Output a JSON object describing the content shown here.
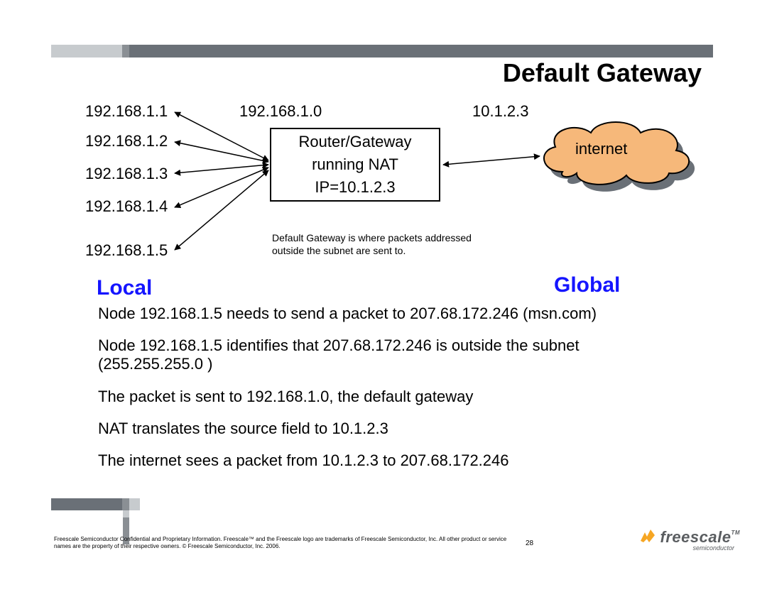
{
  "title": "Default Gateway",
  "ips": [
    "192.168.1.1",
    "192.168.1.2",
    "192.168.1.3",
    "192.168.1.4",
    "192.168.1.5"
  ],
  "gateway_lan_ip": "192.168.1.0",
  "gateway_wan_ip": "10.1.2.3",
  "router": {
    "line1": "Router/Gateway",
    "line2": "running NAT",
    "line3": "IP=10.1.2.3"
  },
  "cloud_label": "internet",
  "explanation": "Default Gateway is where packets addressed outside the subnet are sent to.",
  "local_label": "Local",
  "global_label": "Global",
  "body": [
    "Node 192.168.1.5 needs to send a packet to 207.68.172.246 (msn.com)",
    "Node 192.168.1.5 identifies that 207.68.172.246 is outside the subnet (255.255.255.0 )",
    "The packet is sent to 192.168.1.0, the default gateway",
    "NAT translates the source field to 10.1.2.3",
    "The internet sees a packet from 10.1.2.3 to 207.68.172.246"
  ],
  "footnote": "Freescale Semiconductor Confidential and Proprietary Information. Freescale™ and the Freescale logo are trademarks of Freescale Semiconductor, Inc. All other product or service names are the property of their respective owners. © Freescale Semiconductor, Inc. 2006.",
  "page_number": "28",
  "logo": {
    "name": "freescale",
    "sub": "semiconductor",
    "tm": "TM"
  }
}
